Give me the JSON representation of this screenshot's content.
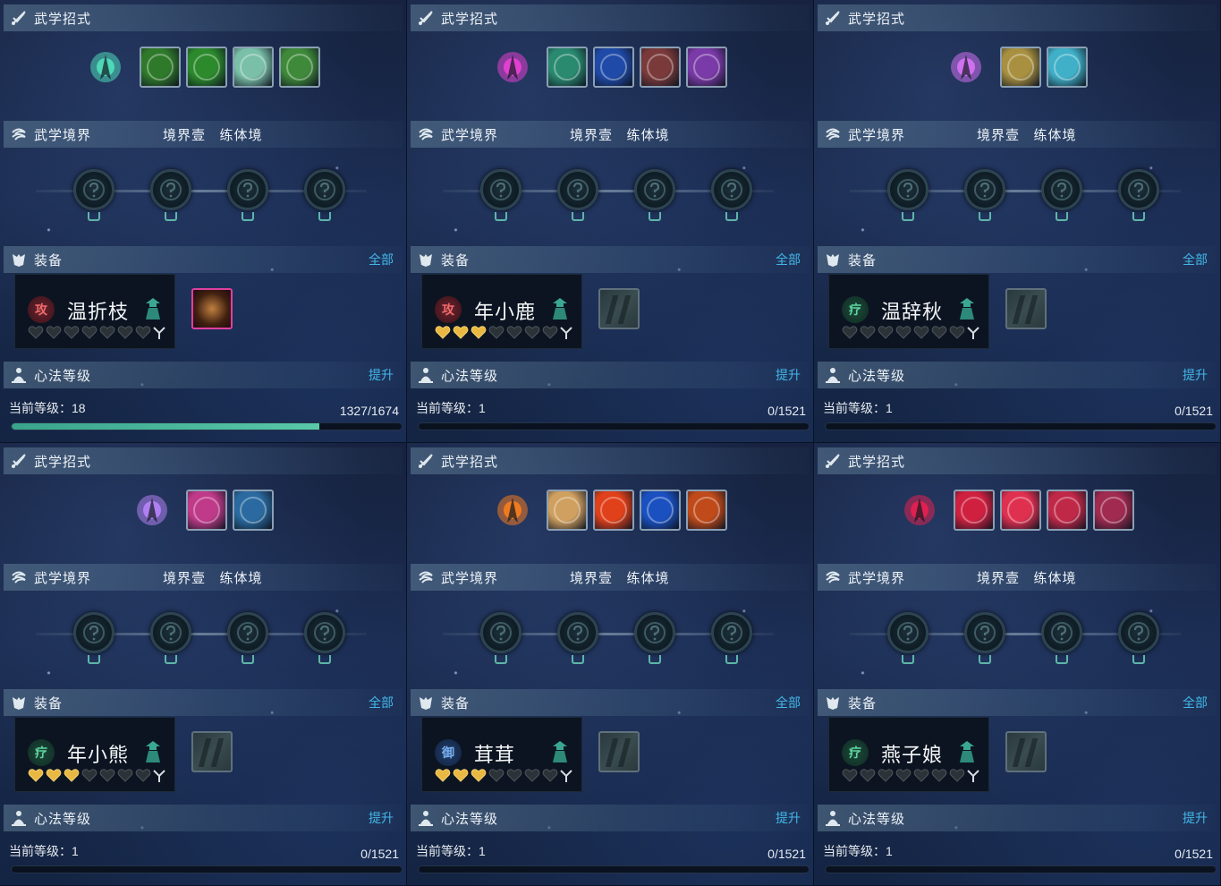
{
  "labels": {
    "skills_title": "武学招式",
    "realm_title": "武学境界",
    "realm_level": "境界壹",
    "realm_stage": "练体境",
    "equip_title": "装备",
    "equip_all": "全部",
    "mind_title": "心法等级",
    "mind_upgrade": "提升",
    "current_level_prefix": "当前等级："
  },
  "panels": [
    {
      "name": "温折枝",
      "role": "攻",
      "role_type": "atk",
      "hearts_filled": 0,
      "level": "18",
      "exp": "1327/1674",
      "progress": 0.79,
      "main_skill_color": "#4fd8b8",
      "skills": [
        "#2f7a2a",
        "#2c8a2c",
        "#7ac0a8",
        "#3f8a3a"
      ],
      "has_item": true
    },
    {
      "name": "年小鹿",
      "role": "攻",
      "role_type": "atk",
      "hearts_filled": 3,
      "level": "1",
      "exp": "0/1521",
      "progress": 0,
      "main_skill_color": "#e040d0",
      "skills": [
        "#2a8a70",
        "#1f4aa8",
        "#7a3a3a",
        "#7a3aa8"
      ],
      "has_item": false
    },
    {
      "name": "温辞秋",
      "role": "疗",
      "role_type": "heal",
      "hearts_filled": 0,
      "level": "1",
      "exp": "0/1521",
      "progress": 0,
      "main_skill_color": "#d070f0",
      "skills": [
        "#a89040",
        "#40b0c8"
      ],
      "has_item": false
    },
    {
      "name": "年小熊",
      "role": "疗",
      "role_type": "heal",
      "hearts_filled": 3,
      "level": "1",
      "exp": "0/1521",
      "progress": 0,
      "main_skill_color": "#b080f0",
      "skills": [
        "#c03a8a",
        "#2a6aa0"
      ],
      "has_item": false
    },
    {
      "name": "茸茸",
      "role": "御",
      "role_type": "def",
      "hearts_filled": 3,
      "level": "1",
      "exp": "0/1521",
      "progress": 0,
      "main_skill_color": "#f07a20",
      "skills": [
        "#d0a060",
        "#e0401a",
        "#1a50c0",
        "#c04a1a"
      ],
      "has_item": false
    },
    {
      "name": "燕子娘",
      "role": "疗",
      "role_type": "heal",
      "hearts_filled": 0,
      "level": "1",
      "exp": "0/1521",
      "progress": 0,
      "main_skill_color": "#e02050",
      "skills": [
        "#d02040",
        "#e03050",
        "#c02848",
        "#a02a50"
      ],
      "has_item": false
    }
  ]
}
